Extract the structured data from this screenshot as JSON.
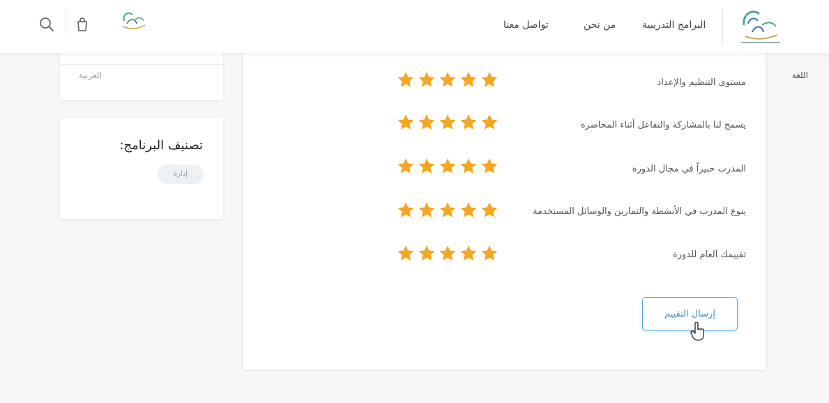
{
  "header": {
    "nav": {
      "programs": "البرامج التدريبية",
      "about": "من نحن",
      "contact": "تواصل معنا"
    },
    "icons": [
      "search-icon",
      "bag-icon"
    ]
  },
  "sidebar": {
    "language_label": "اللغة",
    "language_value": "العربية",
    "classification_title": "تصنيف البرنامج:",
    "classification_tag": "إدارة"
  },
  "rating": {
    "questions": [
      {
        "label": "مستوى التنظيم والإعداد",
        "stars": 5
      },
      {
        "label": "يسمح لنا بالمشاركة والتفاعل أثناء المحاضرة",
        "stars": 5
      },
      {
        "label": "المدرب خبيراً في مجال الدورة",
        "stars": 5
      },
      {
        "label": "ينوع المدرب في الأنشطة والتمارين والوسائل المستخدمة",
        "stars": 5
      },
      {
        "label": "تقييمك العام للدورة",
        "stars": 5
      }
    ],
    "max_stars": 5,
    "submit_label": "إرسال التقييم"
  },
  "colors": {
    "star": "#f5a623",
    "accent": "#3d8fd1",
    "logo_teal": "#4aa89a",
    "logo_blue": "#3b6fb6"
  }
}
